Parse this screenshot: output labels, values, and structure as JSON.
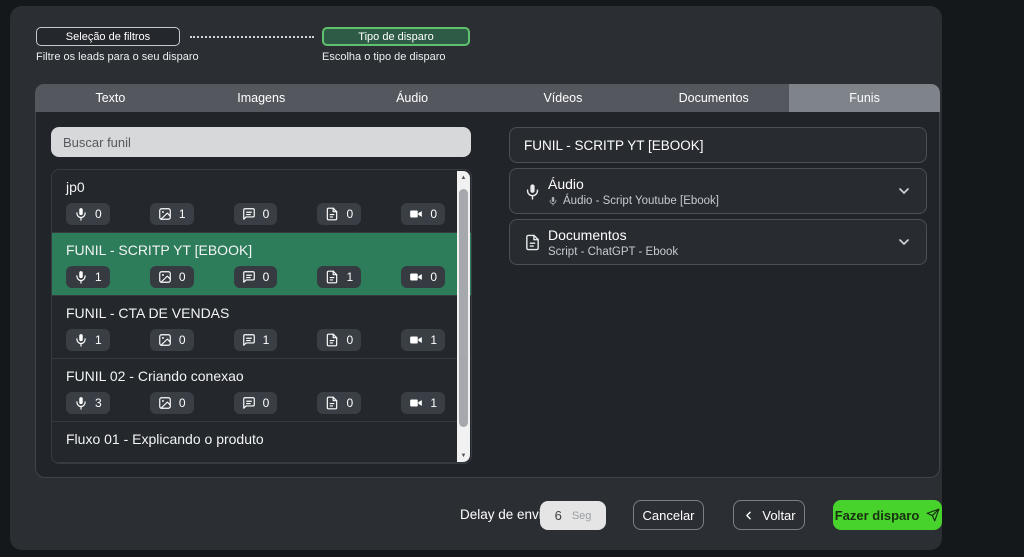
{
  "colors": {
    "accent_green": "#47d32b",
    "selected_row_green": "#2e7d5a",
    "type_step_border": "#5fc16c",
    "panel_bg": "#2b2f34",
    "card_bg": "#212428"
  },
  "stepper": {
    "filter_label": "Seleção de filtros",
    "filter_caption": "Filtre os leads para o seu disparo",
    "type_label": "Tipo de disparo",
    "type_caption": "Escolha o tipo de disparo"
  },
  "tabs": [
    {
      "label": "Texto",
      "active": false
    },
    {
      "label": "Imagens",
      "active": false
    },
    {
      "label": "Áudio",
      "active": false
    },
    {
      "label": "Vídeos",
      "active": false
    },
    {
      "label": "Documentos",
      "active": false
    },
    {
      "label": "Funis",
      "active": true
    }
  ],
  "search": {
    "placeholder": "Buscar funil"
  },
  "funnels": {
    "items": [
      {
        "name": "jp0",
        "selected": false,
        "counts": {
          "audio": "0",
          "image": "1",
          "message": "0",
          "document": "0",
          "video": "0"
        }
      },
      {
        "name": "FUNIL - SCRITP YT [EBOOK]",
        "selected": true,
        "counts": {
          "audio": "1",
          "image": "0",
          "message": "0",
          "document": "1",
          "video": "0"
        }
      },
      {
        "name": "FUNIL - CTA DE VENDAS",
        "selected": false,
        "counts": {
          "audio": "1",
          "image": "0",
          "message": "1",
          "document": "0",
          "video": "1"
        }
      },
      {
        "name": "FUNIL 02 - Criando conexao",
        "selected": false,
        "counts": {
          "audio": "3",
          "image": "0",
          "message": "0",
          "document": "0",
          "video": "1"
        }
      },
      {
        "name": "Fluxo 01 - Explicando o produto",
        "selected": false,
        "clipped": true
      }
    ]
  },
  "detail": {
    "title": "FUNIL - SCRITP YT [EBOOK]",
    "sections": [
      {
        "title": "Áudio",
        "subtitle": "Áudio - Script Youtube [Ebook]"
      },
      {
        "title": "Documentos",
        "subtitle": "Script - ChatGPT - Ebook"
      }
    ]
  },
  "footer": {
    "delay_label": "Delay de envio",
    "delay_value": "6",
    "delay_unit": "Seg",
    "cancel_label": "Cancelar",
    "back_label": "Voltar",
    "send_label": "Fazer disparo"
  },
  "icons": {
    "audio": "mic-icon",
    "image": "image-icon",
    "message": "chat-icon",
    "document": "file-icon",
    "video": "video-icon",
    "chevron_down": "chevron-down-icon",
    "chevron_left": "chevron-left-icon",
    "send": "send-icon",
    "scroll_up_glyph": "▲",
    "scroll_down_glyph": "▼"
  }
}
